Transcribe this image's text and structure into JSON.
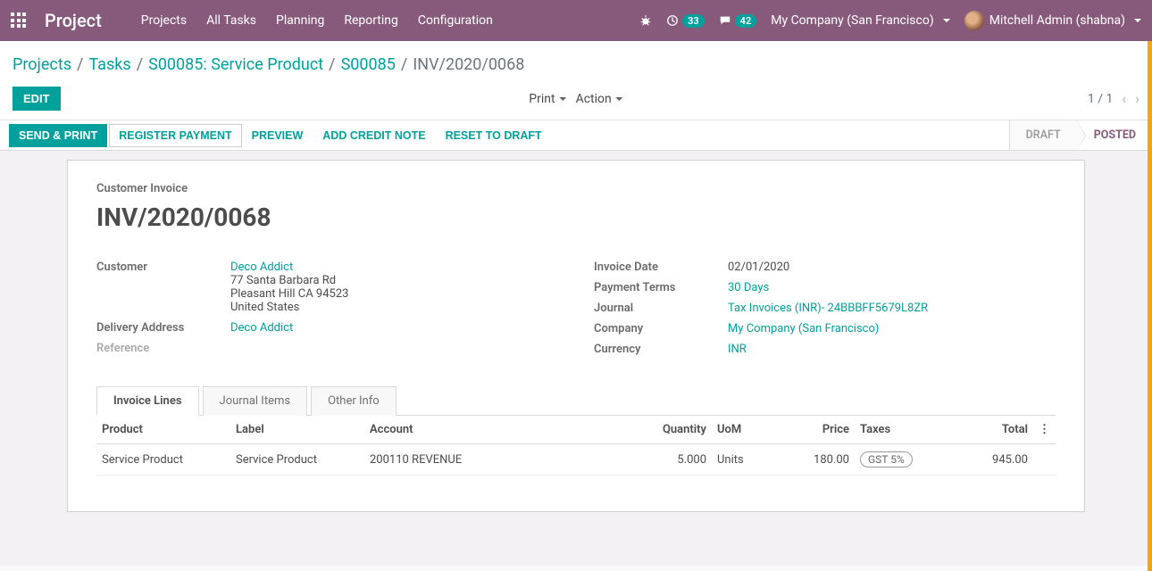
{
  "navbar": {
    "brand": "Project",
    "menu": [
      "Projects",
      "All Tasks",
      "Planning",
      "Reporting",
      "Configuration"
    ],
    "badge_activities": "33",
    "badge_discuss": "42",
    "company": "My Company (San Francisco)",
    "user": "Mitchell Admin (shabna)"
  },
  "breadcrumb": {
    "items": [
      "Projects",
      "Tasks",
      "S00085: Service Product",
      "S00085"
    ],
    "current": "INV/2020/0068"
  },
  "controls": {
    "edit": "EDIT",
    "print": "Print",
    "action": "Action",
    "pager": "1 / 1"
  },
  "statusbar": {
    "send_print": "SEND & PRINT",
    "register_payment": "REGISTER PAYMENT",
    "preview": "PREVIEW",
    "add_credit_note": "ADD CREDIT NOTE",
    "reset_draft": "RESET TO DRAFT",
    "states": {
      "draft": "DRAFT",
      "posted": "POSTED"
    }
  },
  "form": {
    "subtitle": "Customer Invoice",
    "title": "INV/2020/0068",
    "left": {
      "customer_label": "Customer",
      "customer_name": "Deco Addict",
      "customer_addr1": "77 Santa Barbara Rd",
      "customer_addr2": "Pleasant Hill CA 94523",
      "customer_addr3": "United States",
      "delivery_label": "Delivery Address",
      "delivery_value": "Deco Addict",
      "reference_label": "Reference"
    },
    "right": {
      "invoice_date_label": "Invoice Date",
      "invoice_date": "02/01/2020",
      "payment_terms_label": "Payment Terms",
      "payment_terms": "30 Days",
      "journal_label": "Journal",
      "journal": "Tax Invoices (INR)- 24BBBFF5679L8ZR",
      "company_label": "Company",
      "company": "My Company (San Francisco)",
      "currency_label": "Currency",
      "currency": "INR"
    }
  },
  "tabs": {
    "invoice_lines": "Invoice Lines",
    "journal_items": "Journal Items",
    "other_info": "Other Info"
  },
  "table": {
    "headers": {
      "product": "Product",
      "label": "Label",
      "account": "Account",
      "quantity": "Quantity",
      "uom": "UoM",
      "price": "Price",
      "taxes": "Taxes",
      "total": "Total"
    },
    "rows": [
      {
        "product": "Service Product",
        "label": "Service Product",
        "account": "200110 REVENUE",
        "quantity": "5.000",
        "uom": "Units",
        "price": "180.00",
        "tax": "GST 5%",
        "total": "945.00"
      }
    ]
  }
}
